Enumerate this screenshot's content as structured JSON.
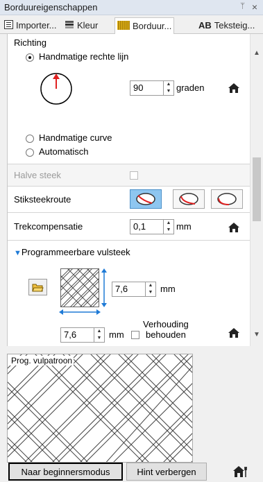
{
  "window": {
    "title": "Borduureigenschappen",
    "pin_glyph": "ᛘ",
    "close_glyph": "×"
  },
  "tabs": [
    {
      "label": "Importer...",
      "icon": "import-icon"
    },
    {
      "label": "Kleur",
      "icon": "color-icon"
    },
    {
      "label": "Borduur...",
      "icon": "embroidery-icon"
    },
    {
      "label": "Teksteig...",
      "icon": "AB"
    }
  ],
  "direction": {
    "heading": "Richting",
    "option_manual_line": "Handmatige rechte lijn",
    "angle_value": "90",
    "angle_unit": "graden",
    "option_manual_curve": "Handmatige curve",
    "option_auto": "Automatisch",
    "selected": "Handmatige rechte lijn"
  },
  "half_stitch": {
    "label": "Halve steek",
    "checked": false
  },
  "run_route": {
    "label": "Stiksteekroute",
    "selected_index": 0
  },
  "pull_comp": {
    "label": "Trekcompensatie",
    "value": "0,1",
    "unit": "mm"
  },
  "prog_fill": {
    "heading": "Programmeerbare vulsteek",
    "height_value": "7,6",
    "height_unit": "mm",
    "width_value": "7,6",
    "width_unit": "mm",
    "keep_ratio_label_1": "Verhouding",
    "keep_ratio_label_2": "behouden",
    "keep_ratio_checked": false
  },
  "preview": {
    "label": "Prog. vulpatroon"
  },
  "footer": {
    "beginner_button": "Naar beginnersmodus",
    "hide_hint_button": "Hint verbergen"
  },
  "colors": {
    "accent_blue": "#1e7ad6",
    "selected_button": "#8ec6f0",
    "arrow_red": "#e02020"
  }
}
